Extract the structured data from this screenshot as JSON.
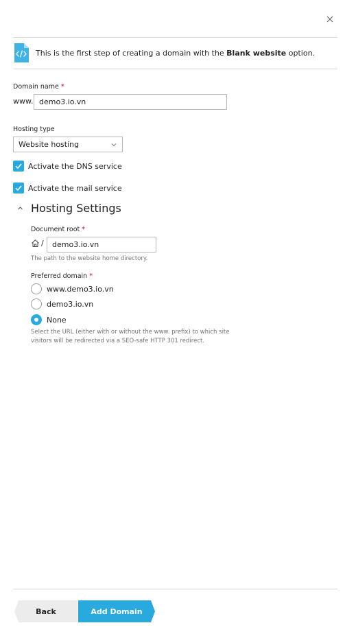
{
  "dialog": {
    "close_icon": "close-icon"
  },
  "info": {
    "icon": "code-file-icon",
    "text_before": "This is the first step of creating a domain with the ",
    "text_bold": "Blank website",
    "text_after": " option."
  },
  "domain": {
    "label": "Domain name",
    "required_mark": "*",
    "prefix": "www.",
    "value": "demo3.io.vn"
  },
  "hosting_type": {
    "label": "Hosting type",
    "selected": "Website hosting"
  },
  "options": {
    "dns_label": "Activate the DNS service",
    "dns_checked": true,
    "mail_label": "Activate the mail service",
    "mail_checked": true
  },
  "hosting_settings": {
    "title": "Hosting Settings",
    "expanded": true,
    "doc_root_label": "Document root",
    "doc_root_required": "*",
    "doc_root_home_icon": "home-icon",
    "doc_root_separator": "/",
    "doc_root_value": "demo3.io.vn",
    "doc_root_hint": "The path to the website home directory.",
    "preferred_label": "Preferred domain",
    "preferred_required": "*",
    "preferred_options": [
      {
        "label": "www.demo3.io.vn",
        "selected": false
      },
      {
        "label": "demo3.io.vn",
        "selected": false
      },
      {
        "label": "None",
        "selected": true
      }
    ],
    "preferred_hint_line1": "Select the URL (either with or without the www. prefix) to which site",
    "preferred_hint_line2": "visitors will be redirected via a SEO-safe HTTP 301 redirect."
  },
  "footer": {
    "back_label": "Back",
    "add_label": "Add Domain"
  },
  "colors": {
    "accent": "#28aade",
    "required": "#d0021b",
    "divider": "#d5d5d5",
    "hint": "#737373",
    "back_button": "#ececec"
  }
}
